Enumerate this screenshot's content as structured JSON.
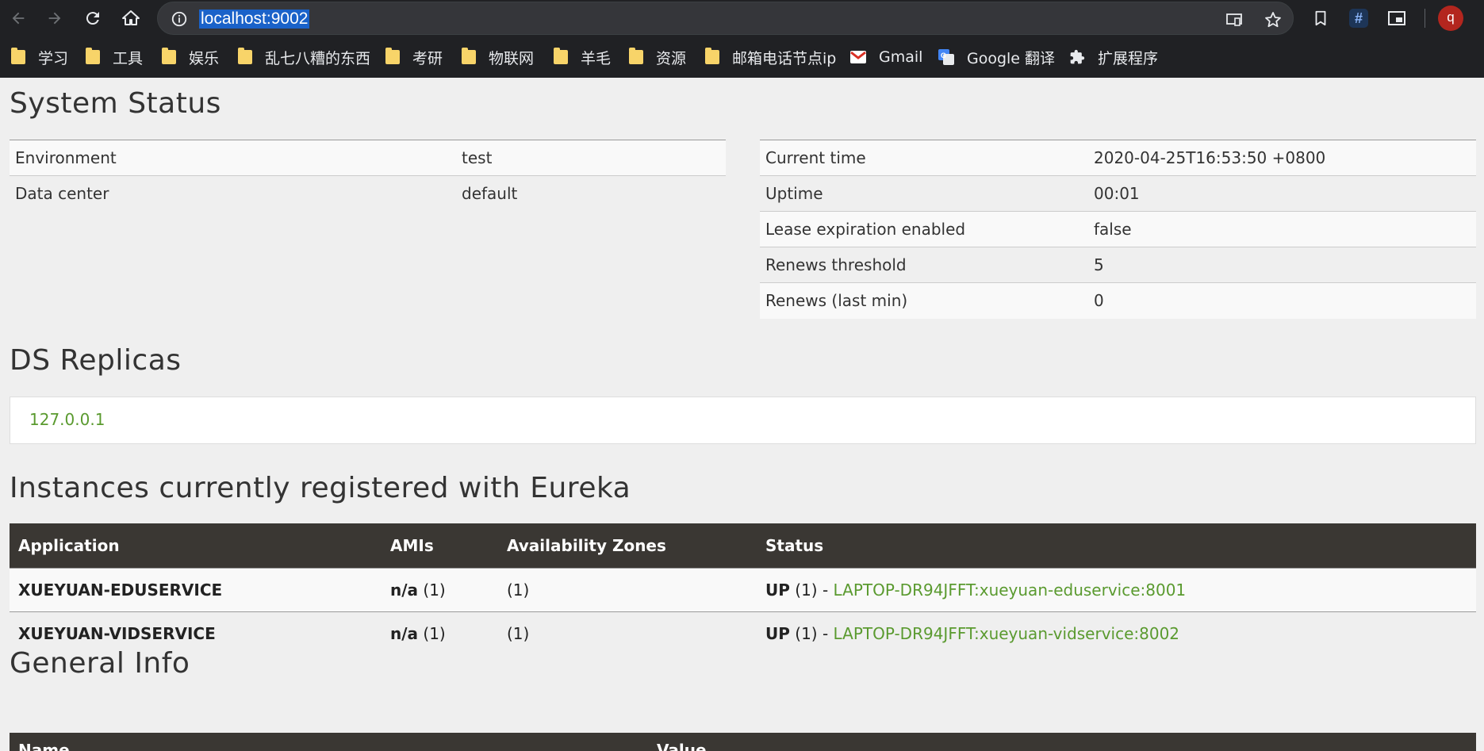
{
  "browser": {
    "url": "localhost:9002",
    "avatar_letter": "q",
    "bookmarks": [
      {
        "label": "学习",
        "type": "folder"
      },
      {
        "label": "工具",
        "type": "folder"
      },
      {
        "label": "娱乐",
        "type": "folder"
      },
      {
        "label": "乱七八糟的东西",
        "type": "folder"
      },
      {
        "label": "考研",
        "type": "folder"
      },
      {
        "label": "物联网",
        "type": "folder"
      },
      {
        "label": "羊毛",
        "type": "folder"
      },
      {
        "label": "资源",
        "type": "folder"
      },
      {
        "label": "邮箱电话节点ip",
        "type": "folder"
      },
      {
        "label": "Gmail",
        "type": "gmail-icon"
      },
      {
        "label": "Google 翻译",
        "type": "google-translate-icon"
      },
      {
        "label": "扩展程序",
        "type": "puzzle-icon"
      }
    ]
  },
  "system_status": {
    "title": "System Status",
    "left": [
      {
        "key": "Environment",
        "value": "test"
      },
      {
        "key": "Data center",
        "value": "default"
      }
    ],
    "right": [
      {
        "key": "Current time",
        "value": "2020-04-25T16:53:50 +0800"
      },
      {
        "key": "Uptime",
        "value": "00:01"
      },
      {
        "key": "Lease expiration enabled",
        "value": "false"
      },
      {
        "key": "Renews threshold",
        "value": "5"
      },
      {
        "key": "Renews (last min)",
        "value": "0"
      }
    ]
  },
  "ds_replicas": {
    "title": "DS Replicas",
    "replicas": [
      "127.0.0.1"
    ]
  },
  "instances": {
    "title": "Instances currently registered with Eureka",
    "columns": [
      "Application",
      "AMIs",
      "Availability Zones",
      "Status"
    ],
    "rows": [
      {
        "application": "XUEYUAN-EDUSERVICE",
        "amis_label": "n/a",
        "amis_count": "(1)",
        "zones": "(1)",
        "status_label": "UP",
        "status_count": "(1) -",
        "instance_link": "LAPTOP-DR94JFFT:xueyuan-eduservice:8001"
      },
      {
        "application": "XUEYUAN-VIDSERVICE",
        "amis_label": "n/a",
        "amis_count": "(1)",
        "zones": "(1)",
        "status_label": "UP",
        "status_count": "(1) -",
        "instance_link": "LAPTOP-DR94JFFT:xueyuan-vidservice:8002"
      }
    ]
  },
  "general_info": {
    "title": "General Info",
    "columns": [
      "Name",
      "Value"
    ]
  },
  "colors": {
    "link_green": "#5a9a2f",
    "table_header_bg": "#3a3733",
    "chrome_bg": "#202124",
    "url_highlight": "#1a62c9"
  }
}
